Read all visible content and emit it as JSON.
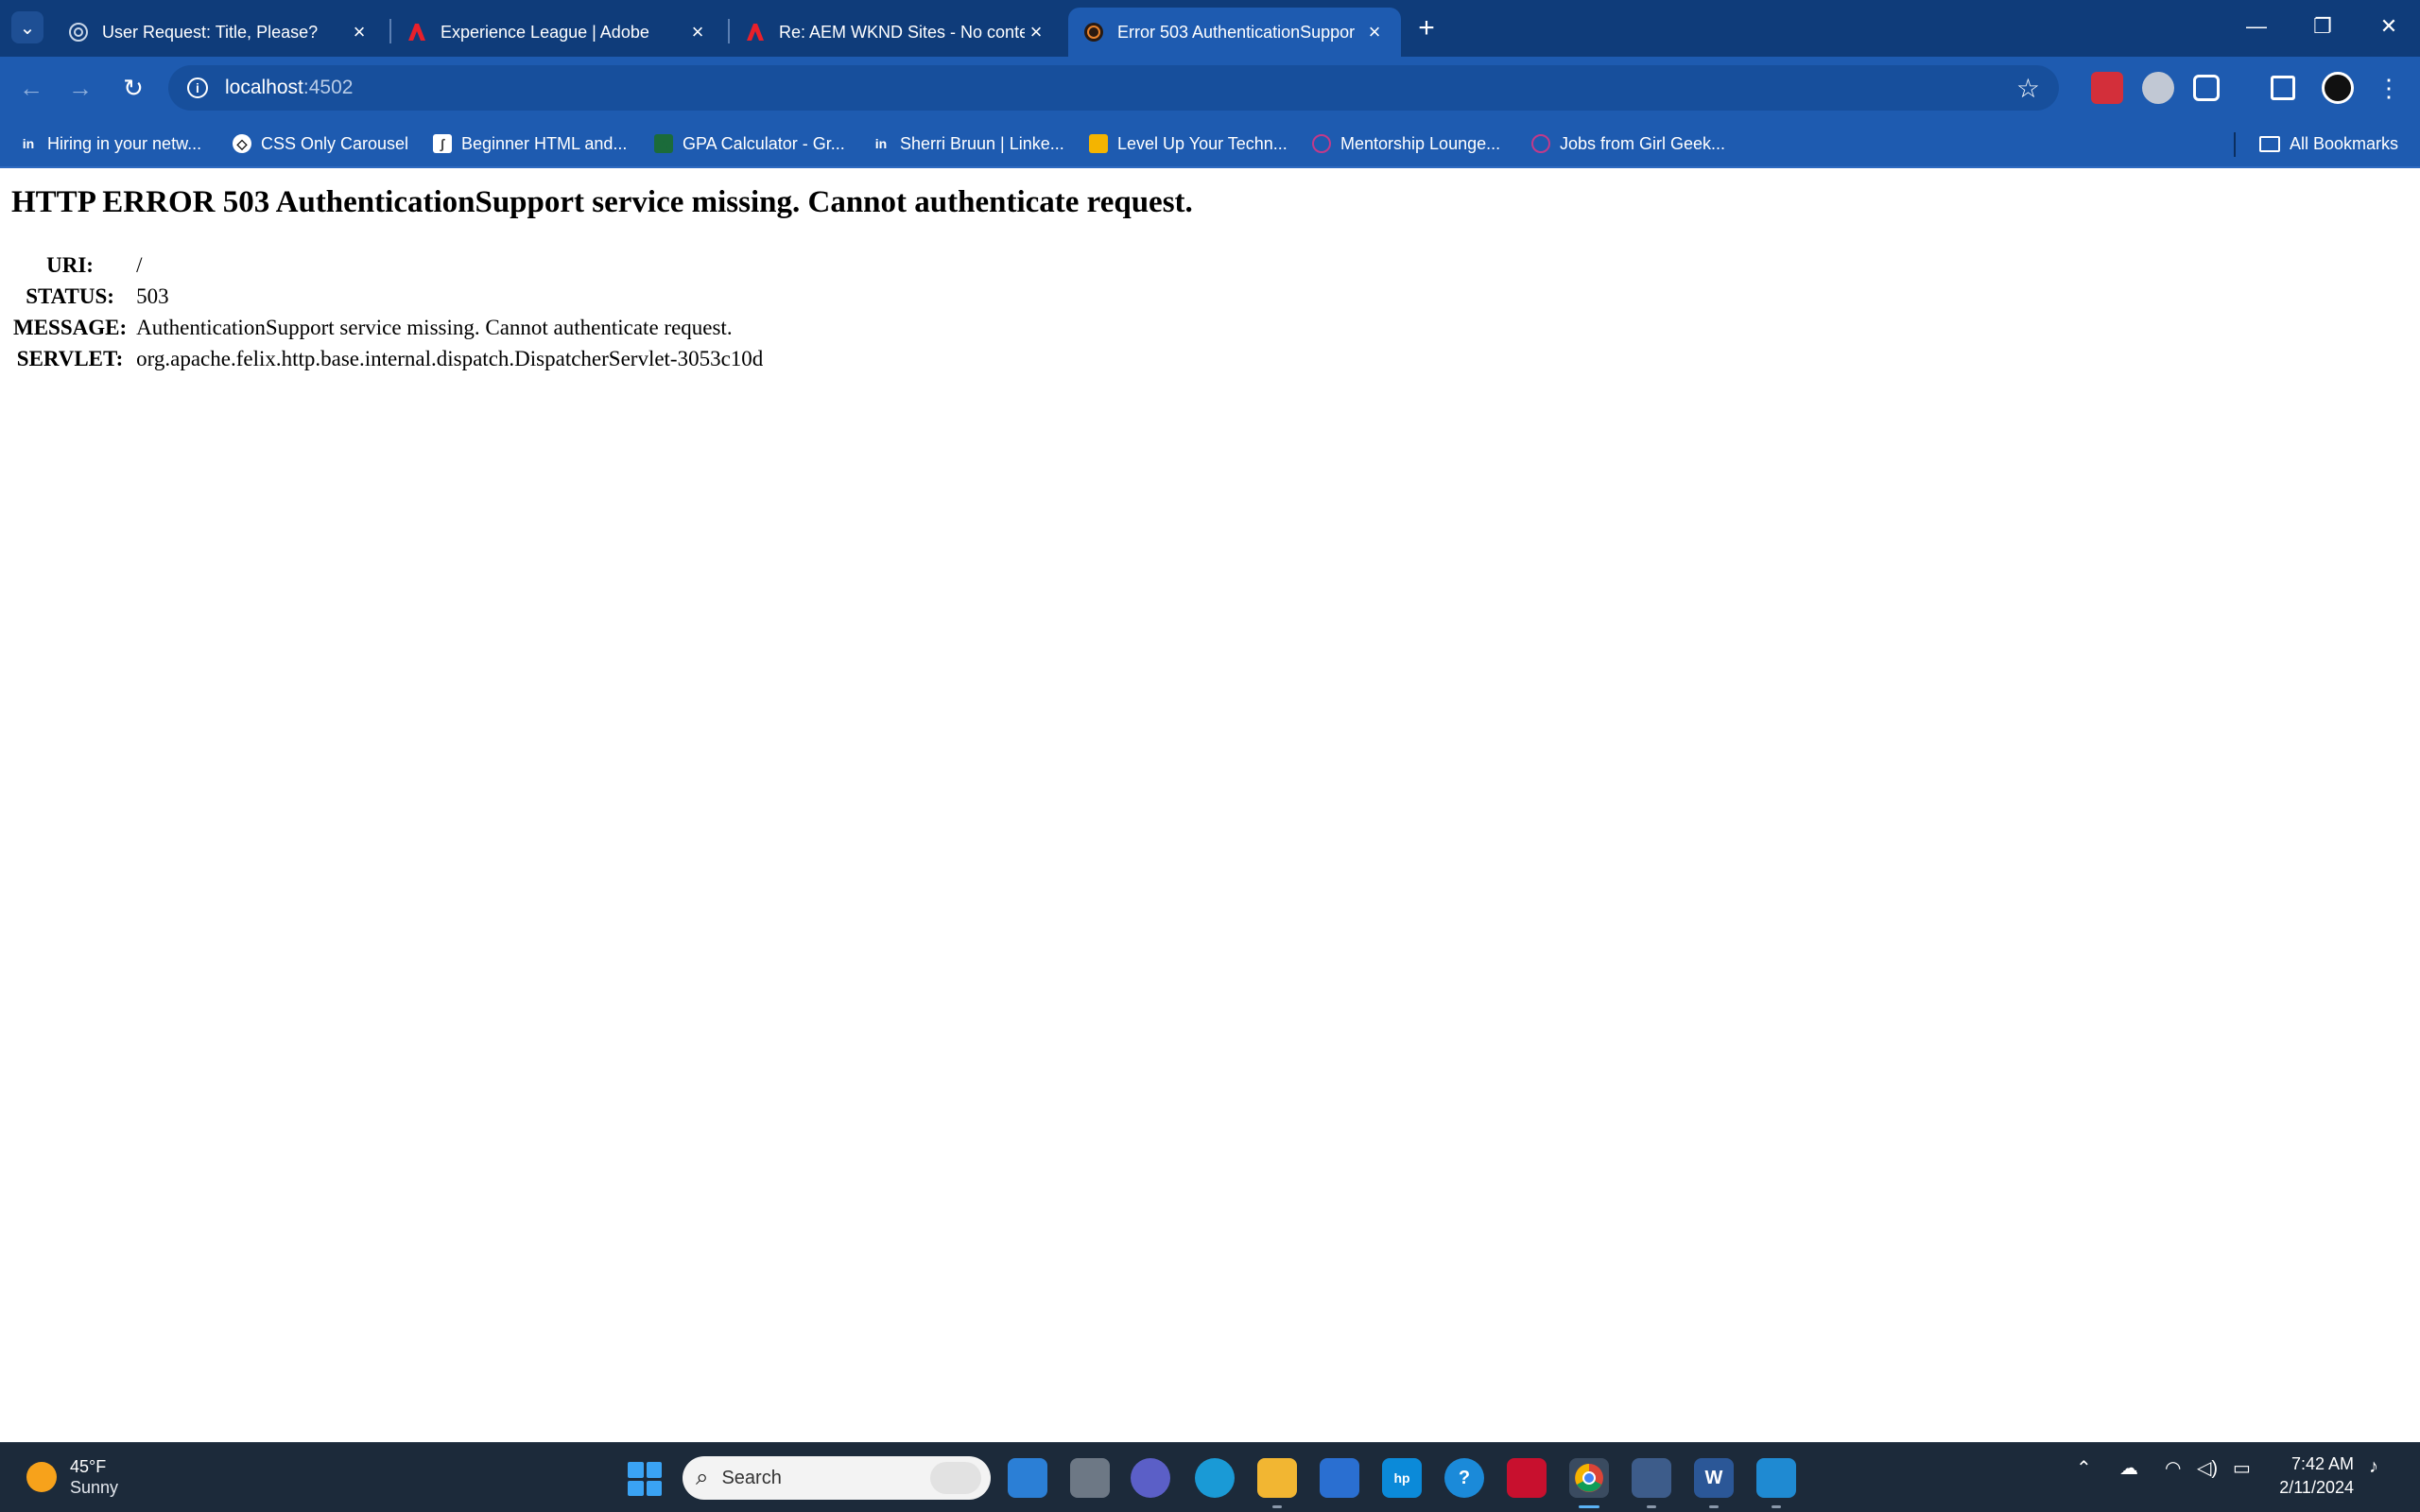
{
  "browser": {
    "tabs": [
      {
        "title": "User Request: Title, Please?",
        "icon": "chatgpt-icon",
        "active": false
      },
      {
        "title": "Experience League | Adobe",
        "icon": "adobe-icon",
        "active": false
      },
      {
        "title": "Re: AEM WKND Sites - No conte",
        "icon": "adobe-icon",
        "active": false
      },
      {
        "title": "Error 503 AuthenticationSuppor",
        "icon": "aem-icon",
        "active": true
      }
    ],
    "address": {
      "host": "localhost",
      "port": ":4502"
    },
    "bookmarks": [
      {
        "label": "Hiring in your netw...",
        "icon": "linkedin-icon"
      },
      {
        "label": "CSS Only Carousel",
        "icon": "codepen-icon"
      },
      {
        "label": "Beginner HTML and...",
        "icon": "page-icon"
      },
      {
        "label": "GPA Calculator - Gr...",
        "icon": "grad-cap-icon"
      },
      {
        "label": "Sherri Bruun | Linke...",
        "icon": "linkedin-icon"
      },
      {
        "label": "Level Up Your Techn...",
        "icon": "slides-icon"
      },
      {
        "label": "Mentorship Lounge...",
        "icon": "girl-geek-icon"
      },
      {
        "label": "Jobs from Girl Geek...",
        "icon": "girl-geek-icon"
      }
    ],
    "all_bookmarks_label": "All Bookmarks",
    "colors": {
      "tabstrip": "#0f3c7a",
      "toolbar": "#1e5bb0"
    }
  },
  "page": {
    "heading": "HTTP ERROR 503 AuthenticationSupport service missing. Cannot authenticate request.",
    "rows": [
      {
        "label": "URI:",
        "value": "/"
      },
      {
        "label": "STATUS:",
        "value": "503"
      },
      {
        "label": "MESSAGE:",
        "value": "AuthenticationSupport service missing. Cannot authenticate request."
      },
      {
        "label": "SERVLET:",
        "value": "org.apache.felix.http.base.internal.dispatch.DispatcherServlet-3053c10d"
      }
    ]
  },
  "taskbar": {
    "weather": {
      "temp": "45°F",
      "condition": "Sunny"
    },
    "search_placeholder": "Search",
    "time": "7:42 AM",
    "date": "2/11/2024"
  }
}
